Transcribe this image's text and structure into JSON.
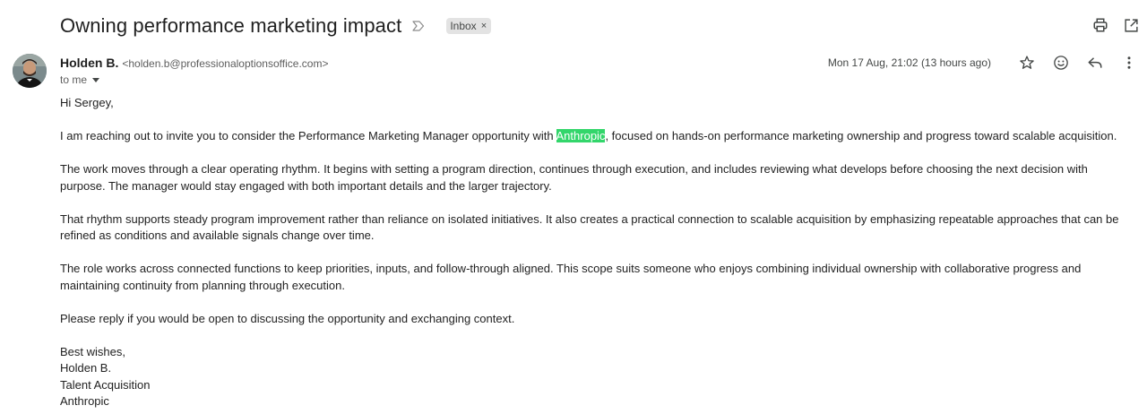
{
  "subject": "Owning performance marketing impact",
  "label": {
    "name": "Inbox",
    "remove": "×"
  },
  "sender": {
    "name": "Holden B.",
    "email": "<holden.b@professionaloptionsoffice.com>"
  },
  "recipient": "to me",
  "timestamp": "Mon 17 Aug, 21:02 (13 hours ago)",
  "body": {
    "greeting": "Hi Sergey,",
    "p1_before": "I am reaching out to invite you to consider the Performance Marketing Manager opportunity with ",
    "p1_highlight": "Anthropic",
    "p1_after": ", focused on hands-on performance marketing ownership and progress toward scalable acquisition.",
    "p2": "The work moves through a clear operating rhythm. It begins with setting a program direction, continues through execution, and includes reviewing what develops before choosing the next decision with purpose. The manager would stay engaged with both important details and the larger trajectory.",
    "p3": "That rhythm supports steady program improvement rather than reliance on isolated initiatives. It also creates a practical connection to scalable acquisition by emphasizing repeatable approaches that can be refined as conditions and available signals change over time.",
    "p4": "The role works across connected functions to keep priorities, inputs, and follow-through aligned. This scope suits someone who enjoys combining individual ownership with collaborative progress and maintaining continuity from planning through execution.",
    "p5": "Please reply if you would be open to discussing the opportunity and exchanging context.",
    "signature": [
      "Best wishes,",
      "Holden B.",
      "Talent Acquisition",
      "Anthropic"
    ]
  },
  "icons": {
    "important": "important-marker-icon",
    "print": "print-icon",
    "open_new_window": "open-in-new-window-icon",
    "star": "star-icon",
    "emoji": "emoji-reaction-icon",
    "reply": "reply-icon",
    "more": "more-options-icon"
  },
  "colors": {
    "highlight": "#33d66b",
    "label_bg": "#e3e3e3"
  }
}
